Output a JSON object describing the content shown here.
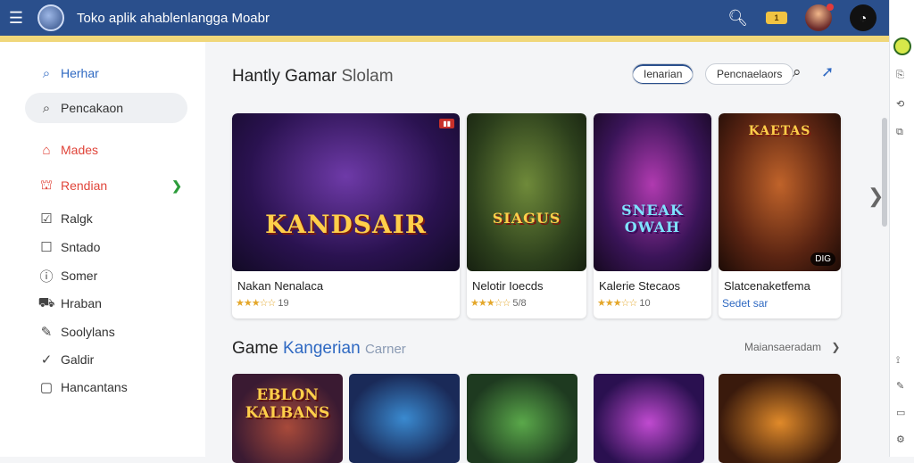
{
  "header": {
    "title": "Toko aplik ahablenlangga Moabr",
    "menu_icon": "hamburger-icon",
    "search_icon": "search-icon",
    "coin_label": "1",
    "profile_icon": "profile-icon"
  },
  "sidebar": {
    "items": [
      {
        "label": "Herhar",
        "icon": "search-icon",
        "color": "#2f69c2"
      },
      {
        "label": "Pencakaon",
        "icon": "search-icon",
        "active": true
      },
      {
        "label": "Mades",
        "icon": "home-icon",
        "color": "#e0453a"
      },
      {
        "label": "Rendian",
        "icon": "store-icon",
        "color": "#e0453a"
      },
      {
        "label": "Ralgk",
        "icon": "checkbox-icon"
      },
      {
        "label": "Sntado",
        "icon": "square-icon"
      },
      {
        "label": "Somer",
        "icon": "info-icon"
      },
      {
        "label": "Hraban",
        "icon": "car-icon"
      },
      {
        "label": "Soolylans",
        "icon": "edit-icon"
      },
      {
        "label": "Galdir",
        "icon": "check-circle-icon"
      },
      {
        "label": "Hancantans",
        "icon": "chat-icon"
      }
    ]
  },
  "featured": {
    "title_main": "Hantly Gamar",
    "title_sub": "Slolam",
    "pills": [
      "Ienarian",
      "Pencnaelaors"
    ],
    "cards": [
      {
        "name": "Nakan Nenalaca",
        "stars": "★★★☆☆",
        "rating": "19",
        "art_title": "KANDSAIR",
        "badge": ""
      },
      {
        "name": "Nelotir Ioecds",
        "stars": "★★★☆☆",
        "rating": "5/8",
        "art_title": "SIAGUS",
        "badge": ""
      },
      {
        "name": "Kalerie Stecaos",
        "stars": "★★★☆☆",
        "rating": "10",
        "art_title": "SNEAK OWAH",
        "badge": ""
      },
      {
        "name": "Slatcenaketfema",
        "rating_text": "Sedet sar",
        "art_title": "KAETAS",
        "badge": "DIG"
      }
    ]
  },
  "categories": {
    "title_main": "Game",
    "title_blue": "Kangerian",
    "title_faint": "Carner",
    "see_all": "Maiansaeradam",
    "cards": [
      {
        "art_title": "EBLON KALBANS"
      },
      {
        "art_title": ""
      },
      {
        "art_title": ""
      },
      {
        "art_title": ""
      },
      {
        "art_title": ""
      }
    ]
  }
}
